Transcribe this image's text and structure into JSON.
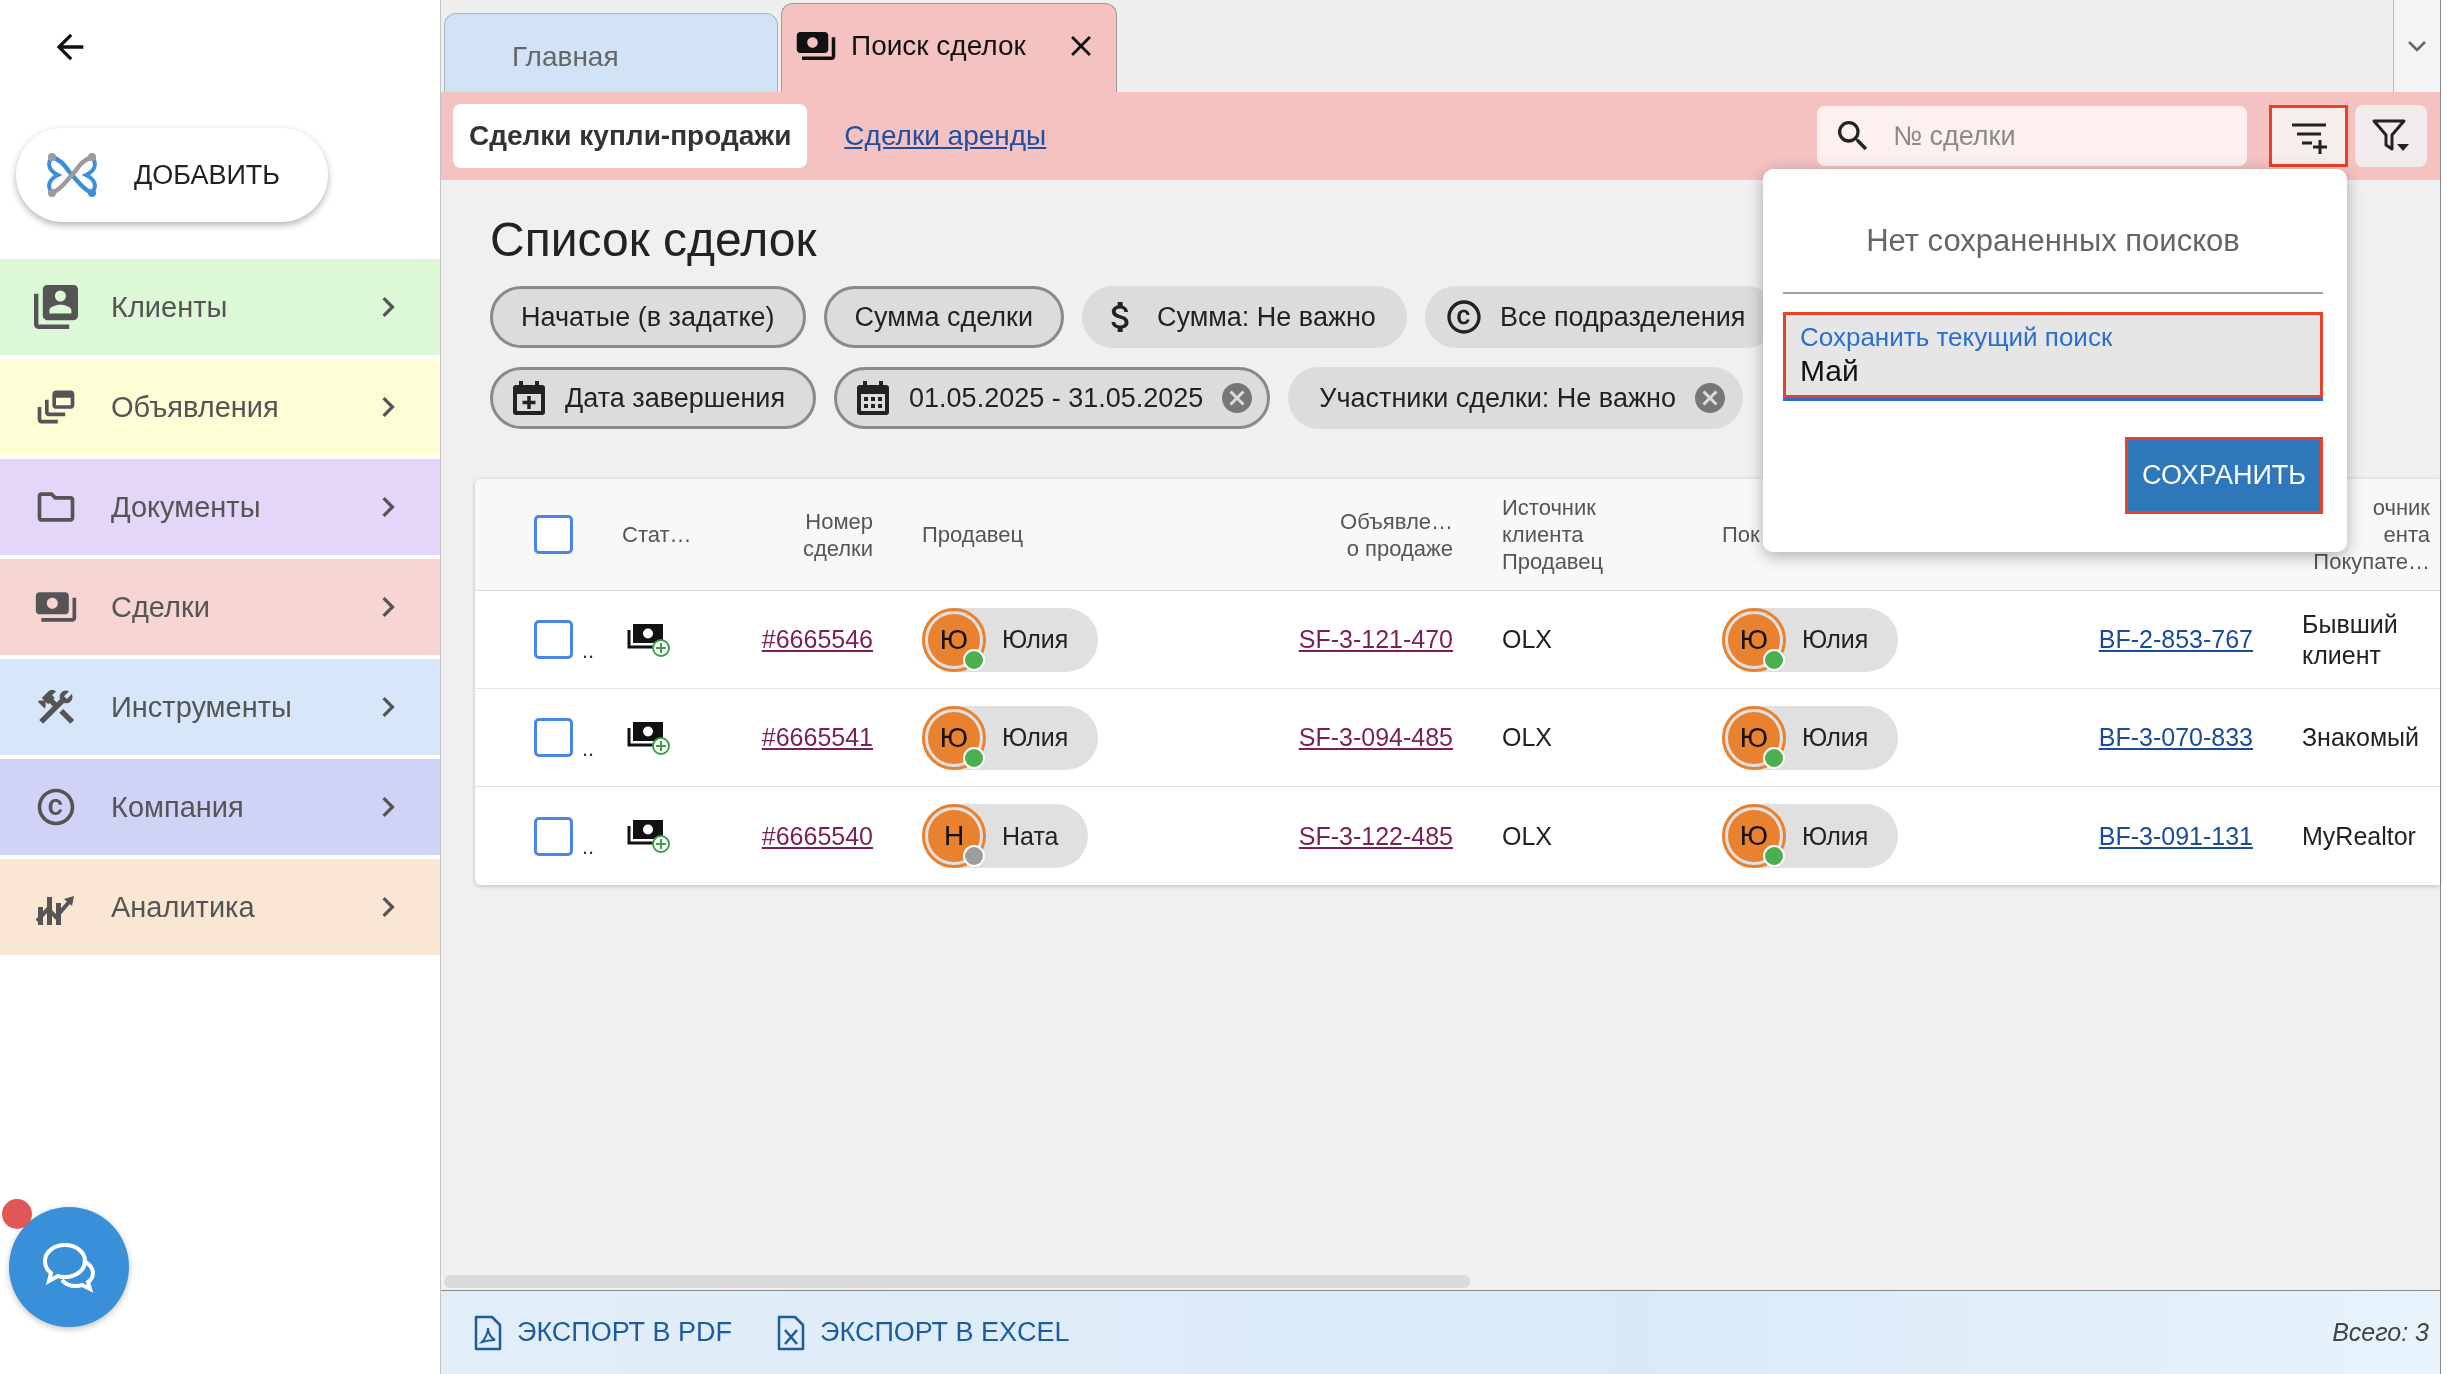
{
  "sidebar": {
    "add_button": {
      "label": "ДОБАВИТЬ"
    },
    "items": [
      {
        "label": "Клиенты",
        "kind": "clients",
        "color": "#dcf8d6"
      },
      {
        "label": "Объявления",
        "kind": "listings",
        "color": "#fdfdd6"
      },
      {
        "label": "Документы",
        "kind": "documents",
        "color": "#e3d6f9"
      },
      {
        "label": "Сделки",
        "kind": "deals",
        "color": "#f7d5d5"
      },
      {
        "label": "Инструменты",
        "kind": "tools",
        "color": "#d7e7f9"
      },
      {
        "label": "Компания",
        "kind": "company",
        "color": "#d1d3f6"
      },
      {
        "label": "Аналитика",
        "kind": "analytics",
        "color": "#f9e6d3"
      }
    ]
  },
  "chat_widget": {
    "unread": true
  },
  "tabs": [
    {
      "label": "Главная",
      "kind": "home",
      "selected": false
    },
    {
      "label": "Поиск сделок",
      "kind": "deals",
      "selected": true
    }
  ],
  "toolbar": {
    "subtabs": [
      {
        "label": "Сделки купли-продажи",
        "selected": true
      },
      {
        "label": "Сделки аренды",
        "selected": false
      }
    ],
    "search": {
      "placeholder": "№ сделки"
    },
    "saved_search_button": {
      "highlighted": true
    }
  },
  "page": {
    "title": "Список сделок",
    "filter_rows": [
      [
        {
          "label": "Начатые (в задатке)",
          "kind": "plain",
          "outlined": true,
          "removable": false
        },
        {
          "label": "Сумма сделки",
          "kind": "plain",
          "outlined": true,
          "removable": false
        },
        {
          "label": "Сумма: Не важно",
          "kind": "amount",
          "outlined": false,
          "removable": false
        },
        {
          "label": "Все подразделения",
          "kind": "department",
          "outlined": false,
          "removable": false
        }
      ],
      [
        {
          "label": "Дата завершения",
          "kind": "date_field",
          "outlined": true,
          "removable": false
        },
        {
          "label": "01.05.2025 - 31.05.2025",
          "kind": "period",
          "outlined": true,
          "removable": true
        },
        {
          "label": "Участники сделки: Не важно",
          "kind": "plain",
          "outlined": false,
          "removable": true
        }
      ]
    ]
  },
  "saved_search_popup": {
    "message": "Нет сохраненных поисков",
    "field": {
      "label": "Сохранить текущий поиск",
      "value": "Май",
      "highlighted": true
    },
    "save_button": {
      "label": "СОХРАНИТЬ",
      "highlighted": true
    }
  },
  "table": {
    "select_all": {
      "checked": false
    },
    "headers": {
      "status": [
        "Стат…"
      ],
      "number": [
        "Номер",
        "сделки"
      ],
      "seller": [
        "Продавец"
      ],
      "sale_listing": [
        "Объявле…",
        "о продаже"
      ],
      "seller_source": [
        "Источник",
        "клиента",
        "Продавец"
      ],
      "buyer": [
        "Пок"
      ],
      "buyer_source": [
        "очник",
        "ента",
        "Покупате…"
      ]
    },
    "rows": [
      {
        "checked": false,
        "column_2": "..",
        "number": "#6665546",
        "seller": {
          "initial": "Ю",
          "name": "Юлия",
          "color": "#4caf50"
        },
        "sale_listing": "SF-3-121-470",
        "seller_source": "OLX",
        "buyer": {
          "initial": "Ю",
          "name": "Юлия",
          "color": "#4caf50"
        },
        "buyer_listing": "BF-2-853-767",
        "buyer_source": "Бывший клиент"
      },
      {
        "checked": false,
        "column_2": "..",
        "number": "#6665541",
        "seller": {
          "initial": "Ю",
          "name": "Юлия",
          "color": "#4caf50"
        },
        "sale_listing": "SF-3-094-485",
        "seller_source": "OLX",
        "buyer": {
          "initial": "Ю",
          "name": "Юлия",
          "color": "#4caf50"
        },
        "buyer_listing": "BF-3-070-833",
        "buyer_source": "Знакомый"
      },
      {
        "checked": false,
        "column_2": "..",
        "number": "#6665540",
        "seller": {
          "initial": "Н",
          "name": "Ната",
          "color": "#9e9e9e"
        },
        "sale_listing": "SF-3-122-485",
        "seller_source": "OLX",
        "buyer": {
          "initial": "Ю",
          "name": "Юлия",
          "color": "#4caf50"
        },
        "buyer_listing": "BF-3-091-131",
        "buyer_source": "MyRealtor"
      }
    ]
  },
  "footer": {
    "actions": [
      {
        "label": "ЭКСПОРТ В PDF",
        "kind": "pdf"
      },
      {
        "label": "ЭКСПОРТ В EXCEL",
        "kind": "excel"
      }
    ],
    "total": "Всего: 3"
  }
}
